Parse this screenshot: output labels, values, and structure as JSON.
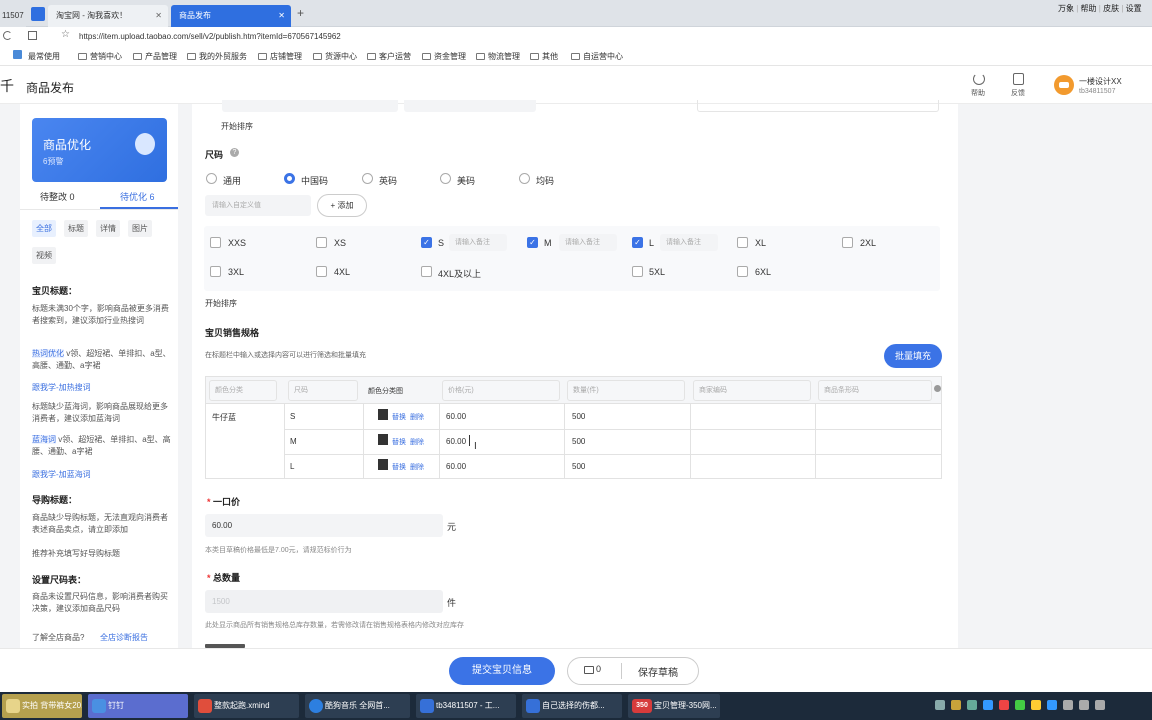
{
  "browser": {
    "tabs": [
      {
        "label": "11507"
      },
      {
        "label": "淘宝网 - 淘我喜欢！"
      },
      {
        "label": "商品发布"
      }
    ],
    "tab_close": "✕",
    "new_tab": "+",
    "right_links": [
      "万象",
      "帮助",
      "皮肤",
      "设置"
    ],
    "url": "https://item.upload.taobao.com/sell/v2/publish.htm?itemId=670567145962",
    "bookmarks": [
      "最常使用",
      "营销中心",
      "产品管理",
      "我的外贸服务",
      "店铺管理",
      "货源中心",
      "客户运营",
      "资金管理",
      "物流管理",
      "其他",
      "自运营中心"
    ]
  },
  "header": {
    "logo_char": "千",
    "title": "商品发布",
    "help_label": "帮助",
    "feedback_label": "反馈",
    "user_name": "一楼设计XX",
    "user_id": "tb34811507"
  },
  "sidebar": {
    "card_title": "商品优化",
    "card_sub": "6预警",
    "tab_pending": "待整改 0",
    "tab_optimize": "待优化 6",
    "chips": [
      "全部",
      "标题",
      "详情",
      "图片",
      "视频"
    ],
    "s1_title": "宝贝标题：",
    "s1_text": "标题未满30个字，影响商品被更多消费者搜索到，建议添加行业热搜词",
    "s1_tag": "热词优化",
    "s1_words": "v领、超短裙、单排扣、a型、高腰、通勤、a字裙",
    "s1_link": "跟我学-加热搜词",
    "s2_text": "标题缺少蓝海词，影响商品展现给更多消费者，建议添加蓝海词",
    "s2_tag": "蓝海词",
    "s2_words": "v领、超短裙、单排扣、a型、高腰、通勤、a字裙",
    "s2_link": "跟我学-加蓝海词",
    "s3_title": "导购标题：",
    "s3_text": "商品缺少导购标题，无法直观向消费者表述商品卖点，请立即添加",
    "s3_more": "推荐补充填写好导购标题",
    "s4_title": "设置尺码表：",
    "s4_text": "商品未设置尺码信息，影响消费者购买决策，建议添加商品尺码",
    "s4_q": "了解全店商品?",
    "s4_link": "全店诊断报告"
  },
  "form": {
    "sort_label_1": "开始排序",
    "size_label": "尺码",
    "size_systems": [
      {
        "label": "通用",
        "selected": false
      },
      {
        "label": "中国码",
        "selected": true
      },
      {
        "label": "英码",
        "selected": false
      },
      {
        "label": "美码",
        "selected": false
      },
      {
        "label": "均码",
        "selected": false
      }
    ],
    "custom_placeholder": "请输入自定义值",
    "add_button": "+ 添加",
    "note_placeholder": "请输入备注",
    "sizes_row1": [
      {
        "label": "XXS",
        "checked": false
      },
      {
        "label": "XS",
        "checked": false
      },
      {
        "label": "S",
        "checked": true
      },
      {
        "label": "M",
        "checked": true
      },
      {
        "label": "L",
        "checked": true
      },
      {
        "label": "XL",
        "checked": false
      },
      {
        "label": "2XL",
        "checked": false
      }
    ],
    "sizes_row2": [
      {
        "label": "3XL",
        "checked": false
      },
      {
        "label": "4XL",
        "checked": false
      },
      {
        "label": "4XL及以上",
        "checked": false
      },
      {
        "label": "5XL",
        "checked": false
      },
      {
        "label": "6XL",
        "checked": false
      }
    ],
    "sort_label_2": "开始排序",
    "spec_title": "宝贝销售规格",
    "spec_desc": "在标题栏中输入或选择内容可以进行筛选和批量填充",
    "batch_button": "批量填充",
    "table_headers": {
      "color": "颜色分类",
      "size": "尺码",
      "image": "颜色分类图",
      "price": "价格(元)",
      "qty": "数量(件)",
      "code": "商家编码",
      "barcode": "商品条形码"
    },
    "color_value": "牛仔蓝",
    "replace_label": "替换",
    "delete_label": "删除",
    "rows": [
      {
        "size": "S",
        "price": "60.00",
        "qty": "500"
      },
      {
        "size": "M",
        "price": "60.00",
        "qty": "500"
      },
      {
        "size": "L",
        "price": "60.00",
        "qty": "500"
      }
    ],
    "price_title": "一口价",
    "price_value": "60.00",
    "price_unit": "元",
    "price_hint": "本类目草稿价格最低是7.00元，请规范标价行为",
    "qty_title": "总数量",
    "qty_value": "1500",
    "qty_unit": "件",
    "qty_hint": "此处显示商品所有销售规格总库存数量，若需修改请在销售规格表格内修改对应库存"
  },
  "footer": {
    "submit": "提交宝贝信息",
    "msg_count": "0",
    "save_draft": "保存草稿"
  },
  "taskbar": [
    {
      "label": "实拍 背带裤女20...",
      "color": "#e7d48a"
    },
    {
      "label": "钉钉",
      "color": "#4a90e2"
    },
    {
      "label": "整款起跑.xmind",
      "color": "#e04e3c"
    },
    {
      "label": "酷狗音乐 全网首...",
      "color": "#2d7fe0"
    },
    {
      "label": "tb34811507 - 工...",
      "color": "#3670d8"
    },
    {
      "label": "自己选择的伤都...",
      "color": "#3670d8"
    },
    {
      "label": "宝贝管理-350网...",
      "color": "#d73b3b"
    }
  ],
  "taskbar_350": "350"
}
